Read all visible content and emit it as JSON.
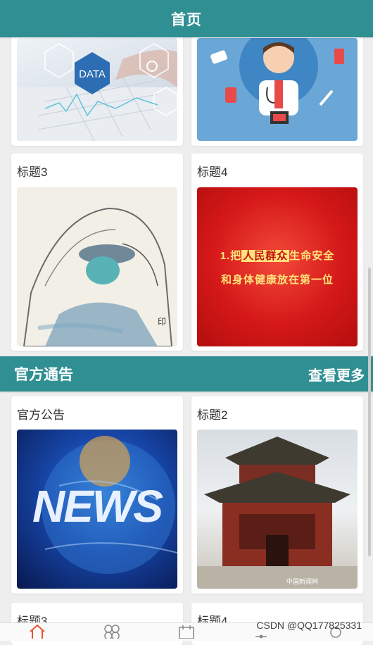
{
  "header": {
    "title": "首页"
  },
  "grid_top": [
    {
      "title": "",
      "image": "data-tech-image"
    },
    {
      "title": "",
      "image": "doctor-illustration-image"
    },
    {
      "title": "标题3",
      "image": "medical-worker-sketch-image"
    },
    {
      "title": "标题4",
      "image": "red-poster-image",
      "poster_line1_pre": "1.把",
      "poster_line1_hl": "人民群众",
      "poster_line1_post": "生命安全",
      "poster_line2": "和身体健康放在第一位"
    }
  ],
  "section": {
    "title": "官方通告",
    "more": "查看更多"
  },
  "grid_bottom": [
    {
      "title": "官方公告",
      "image": "news-globe-image",
      "image_text": "NEWS"
    },
    {
      "title": "标题2",
      "image": "pavilion-photo-image",
      "photo_caption": "中国新闻网"
    },
    {
      "title": "标题3"
    },
    {
      "title": "标题4"
    }
  ],
  "tabbar": {
    "icons": [
      "home-icon",
      "grid-icon",
      "calendar-icon",
      "message-icon",
      "user-icon"
    ]
  },
  "watermark": "CSDN @QQ177825331",
  "colors": {
    "primary": "#2f8f93",
    "tab_active": "#e4572e"
  }
}
